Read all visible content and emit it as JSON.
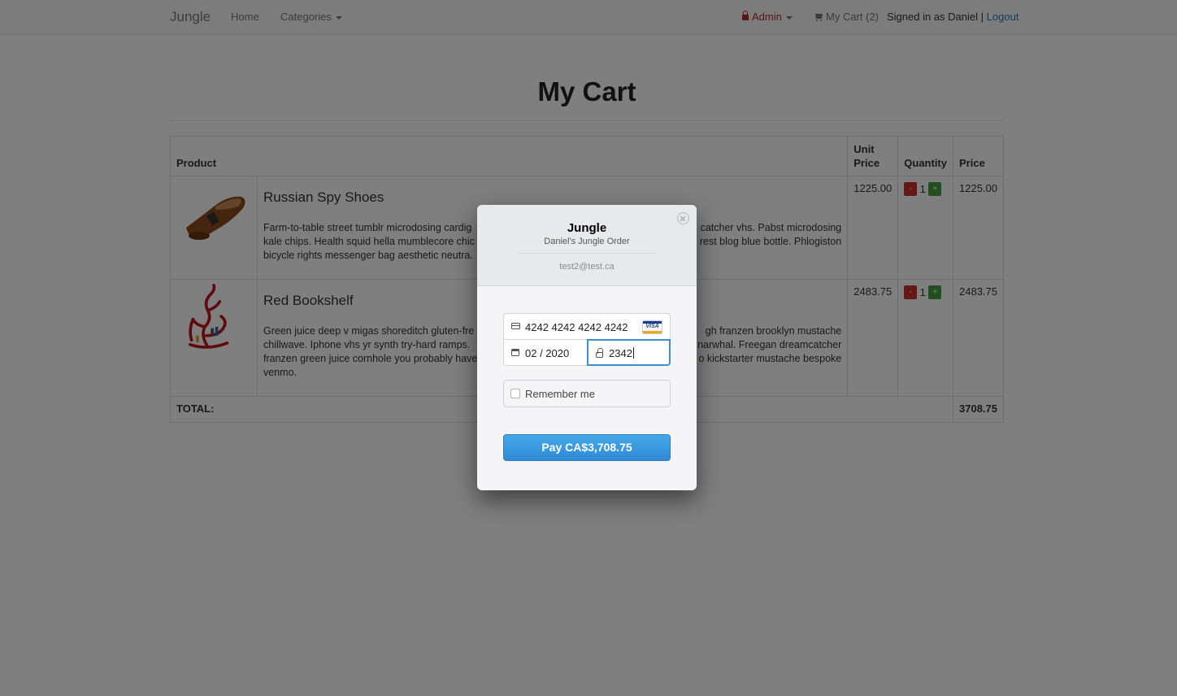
{
  "navbar": {
    "brand": "Jungle",
    "home": "Home",
    "categories": "Categories",
    "admin": "Admin",
    "cart": "My Cart (2)",
    "signed_in": "Signed in as Daniel",
    "separator": "|",
    "logout": "Logout"
  },
  "page": {
    "title": "My Cart"
  },
  "table": {
    "headers": {
      "product": "Product",
      "unit_price": "Unit Price",
      "quantity": "Quantity",
      "price": "Price"
    },
    "rows": [
      {
        "name": "Russian Spy Shoes",
        "desc_left": "Farm-to-table street tumblr microdosing cardig",
        "desc_right": "catcher vhs. Pabst microdosing",
        "desc2_left": "kale chips. Health squid hella mumblecore chic",
        "desc2_right": "rest blog blue bottle. Phlogiston",
        "desc3_left": "bicycle rights messenger bag aesthetic neutra.",
        "unit_price": "1225.00",
        "minus": "-",
        "qty": "1",
        "plus": "+",
        "price": "1225.00"
      },
      {
        "name": "Red Bookshelf",
        "desc_left": "Green juice deep v migas shoreditch gluten-fre",
        "desc_right": "gh franzen brooklyn mustache",
        "desc2_left": "chillwave. Iphone vhs yr synth try-hard ramps.",
        "desc2_right": "narwhal. Freegan dreamcatcher",
        "desc3_left": "franzen green juice cornhole you probably have",
        "desc3_right": "o kickstarter mustache bespoke",
        "desc4_left": "venmo.",
        "unit_price": "2483.75",
        "minus": "-",
        "qty": "1",
        "plus": "+",
        "price": "2483.75"
      }
    ],
    "total_label": "TOTAL:",
    "total_value": "3708.75"
  },
  "checkout": {
    "merchant": "Jungle",
    "description": "Daniel's Jungle Order",
    "email": "test2@test.ca",
    "card_number": "4242 4242 4242 4242",
    "card_brand": "VISA",
    "expiry": "02 / 2020",
    "cvc": "2342",
    "remember_label": "Remember me",
    "pay_label": "Pay CA$3,708.75"
  },
  "colors": {
    "pay_button": "#2f8ad4",
    "focus_border": "#3c90d8",
    "qty_minus": "#c9302c",
    "qty_plus": "#449d44",
    "admin": "#b52b27",
    "link": "#337ab7"
  },
  "icons": {
    "admin": "lock-icon",
    "cart": "shopping-cart-icon",
    "card": "credit-card-icon",
    "expiry": "calendar-icon",
    "cvc": "lock-icon",
    "close": "close-icon"
  }
}
